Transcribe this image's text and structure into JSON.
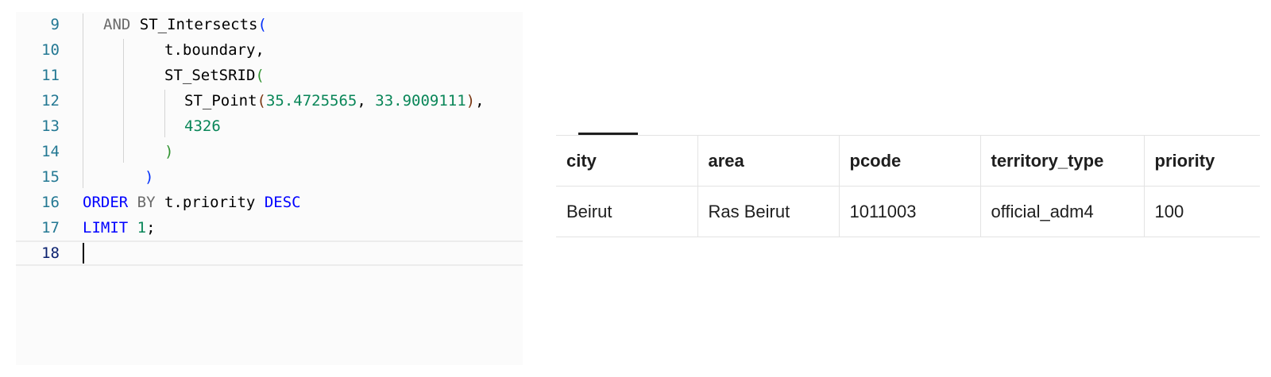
{
  "editor": {
    "lines": [
      {
        "num": "9",
        "tokens": [
          {
            "t": "AND ",
            "c": "kwdim"
          },
          {
            "t": "ST_Intersects",
            "c": "id"
          },
          {
            "t": "(",
            "c": "paren1"
          }
        ]
      },
      {
        "num": "10",
        "tokens": [
          {
            "t": "t.boundary,",
            "c": "id"
          }
        ]
      },
      {
        "num": "11",
        "tokens": [
          {
            "t": "ST_SetSRID",
            "c": "id"
          },
          {
            "t": "(",
            "c": "paren2"
          }
        ]
      },
      {
        "num": "12",
        "tokens": [
          {
            "t": "ST_Point",
            "c": "id"
          },
          {
            "t": "(",
            "c": "paren3"
          },
          {
            "t": "35.4725565",
            "c": "num"
          },
          {
            "t": ", ",
            "c": "id"
          },
          {
            "t": "33.9009111",
            "c": "num"
          },
          {
            "t": ")",
            "c": "paren3"
          },
          {
            "t": ",",
            "c": "id"
          }
        ]
      },
      {
        "num": "13",
        "tokens": [
          {
            "t": "4326",
            "c": "num"
          }
        ]
      },
      {
        "num": "14",
        "tokens": [
          {
            "t": ")",
            "c": "paren2"
          }
        ]
      },
      {
        "num": "15",
        "tokens": [
          {
            "t": ")",
            "c": "paren1"
          }
        ]
      },
      {
        "num": "16",
        "tokens": [
          {
            "t": "ORDER",
            "c": "kw"
          },
          {
            "t": " BY ",
            "c": "kwdim"
          },
          {
            "t": "t.priority ",
            "c": "id"
          },
          {
            "t": "DESC",
            "c": "kw"
          }
        ]
      },
      {
        "num": "17",
        "tokens": [
          {
            "t": "LIMIT ",
            "c": "kw"
          },
          {
            "t": "1",
            "c": "num"
          },
          {
            "t": ";",
            "c": "id"
          }
        ]
      },
      {
        "num": "18",
        "tokens": []
      }
    ],
    "current_line": "18"
  },
  "results": {
    "columns": [
      "city",
      "area",
      "pcode",
      "territory_type",
      "priority"
    ],
    "rows": [
      [
        "Beirut",
        "Ras Beirut",
        "1011003",
        "official_adm4",
        "100"
      ]
    ]
  }
}
